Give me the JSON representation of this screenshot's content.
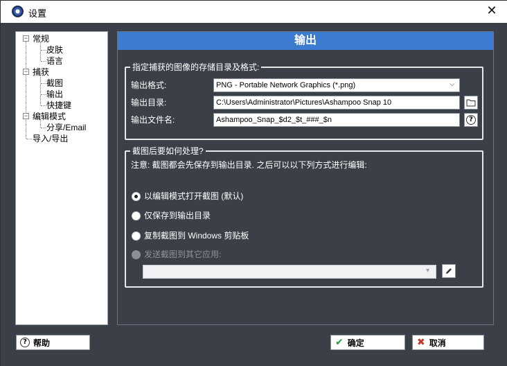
{
  "window": {
    "title": "设置",
    "close_symbol": "✕"
  },
  "sidebar": {
    "items": [
      {
        "label": "常规",
        "level": 0,
        "expanded": true
      },
      {
        "label": "皮肤",
        "level": 1
      },
      {
        "label": "语言",
        "level": 1
      },
      {
        "label": "捕获",
        "level": 0,
        "expanded": true
      },
      {
        "label": "截图",
        "level": 1
      },
      {
        "label": "输出",
        "level": 1,
        "selected": true
      },
      {
        "label": "快捷键",
        "level": 1
      },
      {
        "label": "编辑模式",
        "level": 0,
        "expanded": true
      },
      {
        "label": "分享/Email",
        "level": 1
      },
      {
        "label": "导入/导出",
        "level": 0
      }
    ],
    "toggle_symbol": "−"
  },
  "header": {
    "title": "输出"
  },
  "output_group": {
    "legend": "指定捕获的图像的存储目录及格式:",
    "format_label": "输出格式:",
    "format_value": "PNG - Portable Network Graphics (*.png)",
    "dir_label": "输出目录:",
    "dir_value": "C:\\Users\\Administrator\\Pictures\\Ashampoo Snap 10",
    "filename_label": "输出文件名:",
    "filename_value": "Ashampoo_Snap_$d2_$t_###_$n"
  },
  "post_group": {
    "legend": "截图后要如何处理?",
    "note": "注意: 截图都会先保存到输出目录. 之后可以以下列方式进行编辑:",
    "options": [
      {
        "label": "以编辑模式打开截图 (默认)",
        "checked": true,
        "disabled": false
      },
      {
        "label": "仅保存到输出目录",
        "checked": false,
        "disabled": false
      },
      {
        "label": "复制截图到 Windows 剪贴板",
        "checked": false,
        "disabled": false
      },
      {
        "label": "发送截图到其它应用:",
        "checked": false,
        "disabled": true
      }
    ],
    "app_select_value": ""
  },
  "footer": {
    "help_label": "帮助",
    "ok_label": "确定",
    "cancel_label": "取消"
  },
  "icons": {
    "folder": "folder-icon",
    "help": "question-icon",
    "edit": "pencil-icon",
    "check": "check-icon",
    "cancel": "x-icon"
  },
  "colors": {
    "header_blue": "#3c7bcf",
    "panel_bg": "#3a3f48",
    "ok_green": "#2e9b3a",
    "cancel_red": "#c0392b"
  }
}
